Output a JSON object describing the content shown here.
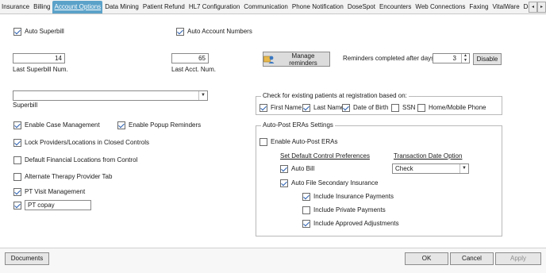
{
  "tabs": [
    {
      "label": "Insurance",
      "active": false
    },
    {
      "label": "Billing",
      "active": false
    },
    {
      "label": "Account Options",
      "active": true
    },
    {
      "label": "Data Mining",
      "active": false
    },
    {
      "label": "Patient Refund",
      "active": false
    },
    {
      "label": "HL7 Configuration",
      "active": false
    },
    {
      "label": "Communication",
      "active": false
    },
    {
      "label": "Phone Notification",
      "active": false
    },
    {
      "label": "DoseSpot",
      "active": false
    },
    {
      "label": "Encounters",
      "active": false
    },
    {
      "label": "Web Connections",
      "active": false
    },
    {
      "label": "Faxing",
      "active": false
    },
    {
      "label": "VitalWare",
      "active": false
    },
    {
      "label": "Documents",
      "active": false
    }
  ],
  "tab_scroll": {
    "left_icon": "left-arrow-icon",
    "right_icon": "right-arrow-icon",
    "left": "◂",
    "right": "▸"
  },
  "options": {
    "auto_superbill": {
      "label": "Auto Superbill",
      "checked": true
    },
    "auto_account_numbers": {
      "label": "Auto Account Numbers",
      "checked": true
    },
    "last_superbill_num": {
      "value": "14",
      "label": "Last Superbill Num."
    },
    "last_acct_num": {
      "value": "65",
      "label": "Last Acct. Num."
    },
    "manage_reminders": {
      "label": "Manage reminders",
      "icon": "reminders-icon"
    },
    "reminders_completed": {
      "label": "Reminders completed after days",
      "value": "3"
    },
    "disable_button": {
      "label": "Disable"
    },
    "superbill": {
      "label": "Superbill",
      "value": ""
    },
    "enable_case_management": {
      "label": "Enable Case Management",
      "checked": true
    },
    "enable_popup_reminders": {
      "label": "Enable Popup Reminders",
      "checked": true
    },
    "lock_providers": {
      "label": "Lock Providers/Locations in Closed Controls",
      "checked": true
    },
    "default_financial_locations": {
      "label": "Default Financial Locations from Control",
      "checked": false
    },
    "alternate_therapy": {
      "label": "Alternate Therapy Provider Tab",
      "checked": false
    },
    "pt_visit_management": {
      "label": "PT Visit Management",
      "checked": true
    },
    "pt_copay": {
      "checked": true,
      "value": "PT copay"
    }
  },
  "registration_check": {
    "title": "Check for existing patients at registration based on:",
    "items": [
      {
        "label": "First Name",
        "checked": true
      },
      {
        "label": "Last Name",
        "checked": true
      },
      {
        "label": "Date of Birth",
        "checked": true
      },
      {
        "label": "SSN",
        "checked": false
      },
      {
        "label": "Home/Mobile Phone",
        "checked": false
      }
    ]
  },
  "era_settings": {
    "title": "Auto-Post ERAs Settings",
    "enable": {
      "label": "Enable Auto-Post ERAs",
      "checked": false
    },
    "default_prefs_heading": "Set Default Control Preferences",
    "transaction_date_heading": "Transaction Date Option",
    "transaction_date_value": "Check",
    "auto_bill": {
      "label": "Auto Bill",
      "checked": true
    },
    "auto_file_secondary": {
      "label": "Auto File Secondary Insurance",
      "checked": true
    },
    "include_insurance_payments": {
      "label": "Include Insurance Payments",
      "checked": true
    },
    "include_private_payments": {
      "label": "Include Private Payments",
      "checked": false
    },
    "include_approved_adjustments": {
      "label": "Include Approved Adjustments",
      "checked": true
    }
  },
  "footer": {
    "documents": "Documents",
    "ok": "OK",
    "cancel": "Cancel",
    "apply": "Apply"
  },
  "colors": {
    "active_tab": "#5ba2c9",
    "check": "#2a5fb0"
  }
}
